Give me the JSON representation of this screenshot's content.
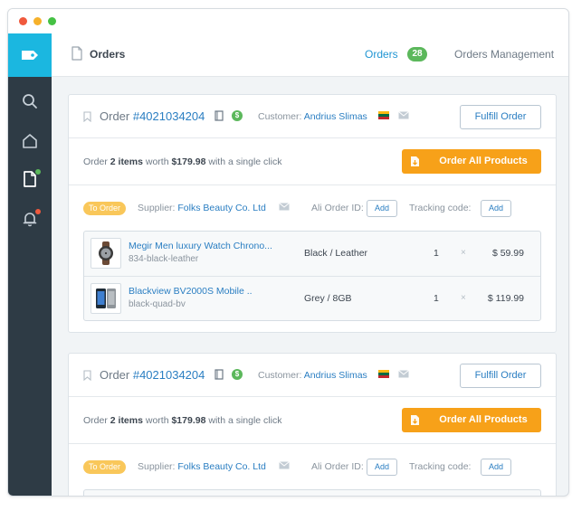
{
  "window": {
    "controls": [
      "close",
      "minimize",
      "maximize"
    ]
  },
  "sidebar": {
    "logo_icon": "tag-icon",
    "items": [
      {
        "icon": "search-icon"
      },
      {
        "icon": "home-icon"
      },
      {
        "icon": "document-icon",
        "badge_color": "#5cb85c"
      },
      {
        "icon": "bell-icon",
        "badge_color": "#f0593d"
      }
    ],
    "colors": {
      "background": "#2e3b45",
      "logo_bg": "#1bb7e0"
    }
  },
  "header": {
    "title": "Orders",
    "tabs": [
      {
        "label": "Orders",
        "count": "28"
      },
      {
        "label": "Orders Management"
      }
    ]
  },
  "orders": [
    {
      "order_prefix": "Order ",
      "order_number": "#4021034204",
      "customer_label": "Customer:",
      "customer_name": "Andrius Slimas",
      "fulfill_label": "Fulfill Order",
      "summary": {
        "pre": "Order ",
        "count": "2 items",
        "mid": " worth ",
        "amount": "$179.98",
        "post": " with a single click"
      },
      "order_all_label": "Order All Products",
      "status": "To Order",
      "supplier_label": "Supplier:",
      "supplier_name": "Folks Beauty Co. Ltd",
      "ali_label": "Ali Order ID:",
      "ali_add": "Add",
      "tracking_label": "Tracking code:",
      "tracking_add": "Add",
      "items": [
        {
          "name": "Megir Men luxury Watch Chrono...",
          "sku": "834-black-leather",
          "variant": "Black / Leather",
          "qty": "1",
          "x": "×",
          "price": "$ 59.99"
        },
        {
          "name": "Blackview BV2000S Mobile ..",
          "sku": "black-quad-bv",
          "variant": "Grey / 8GB",
          "qty": "1",
          "x": "×",
          "price": "$ 119.99"
        }
      ]
    },
    {
      "order_prefix": "Order ",
      "order_number": "#4021034204",
      "customer_label": "Customer:",
      "customer_name": "Andrius Slimas",
      "fulfill_label": "Fulfill Order",
      "summary": {
        "pre": "Order ",
        "count": "2 items",
        "mid": " worth ",
        "amount": "$179.98",
        "post": " with a single click"
      },
      "order_all_label": "Order All Products",
      "status": "To Order",
      "supplier_label": "Supplier:",
      "supplier_name": "Folks Beauty Co. Ltd",
      "ali_label": "Ali Order ID:",
      "ali_add": "Add",
      "tracking_label": "Tracking code:",
      "tracking_add": "Add"
    }
  ],
  "colors": {
    "accent": "#2a7ec2",
    "order_button": "#f7a119",
    "status_pill": "#f9c75a",
    "count_badge": "#5cb85c"
  }
}
